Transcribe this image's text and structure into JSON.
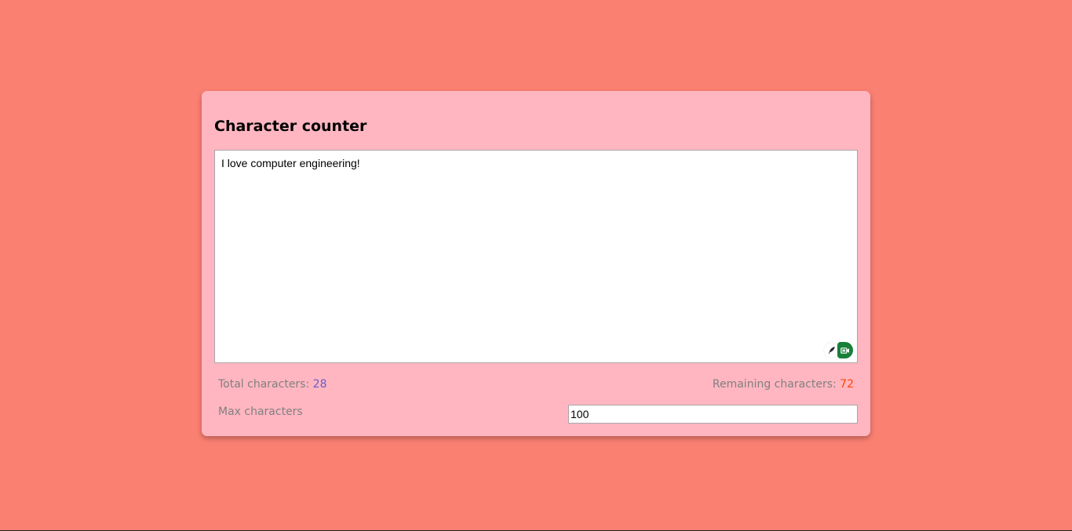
{
  "page": {
    "background_color": "#fa8072"
  },
  "card": {
    "background_color": "#ffb6c1",
    "title": "Character counter"
  },
  "editor": {
    "value": "I love computer engineering!"
  },
  "extension_icons": [
    {
      "name": "feather-icon"
    },
    {
      "name": "video-meet-icon",
      "color": "#188038"
    }
  ],
  "stats": {
    "total_label": "Total characters: ",
    "total_value": "28",
    "total_value_color": "#6a5acd",
    "remaining_label": "Remaining characters: ",
    "remaining_value": "72",
    "remaining_value_color": "#ff4500"
  },
  "max_characters": {
    "label": "Max characters",
    "value": "100"
  }
}
